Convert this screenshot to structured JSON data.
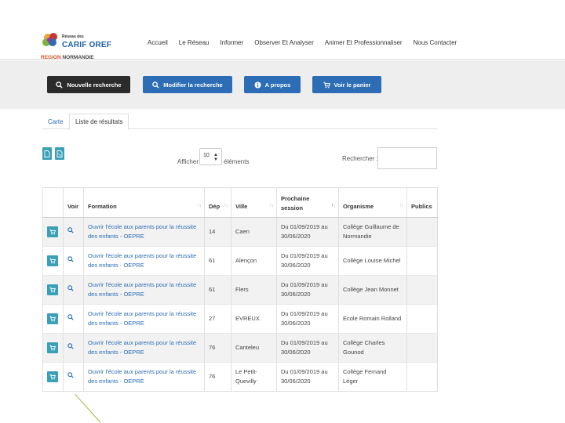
{
  "logo": {
    "network_label": "Réseau des",
    "brand": "CARIF OREF",
    "region_prefix": "REGION",
    "region_name": "NORMANDIE"
  },
  "nav": {
    "items": [
      "Accueil",
      "Le Réseau",
      "Informer",
      "Observer Et Analyser",
      "Animer Et Professionnaliser",
      "Nous Contacter"
    ]
  },
  "toolbar": {
    "new_search": "Nouvelle recherche",
    "modify_search": "Modifier la recherche",
    "about": "A propos",
    "view_cart": "Voir le panier"
  },
  "tabs": {
    "map": "Carte",
    "results": "Liste de résultats"
  },
  "listing": {
    "show_label": "Afficher",
    "page_size": "10",
    "elements_label": "éléments",
    "search_label": "Rechercher :",
    "search_value": ""
  },
  "table": {
    "headers": {
      "voir": "Voir",
      "formation": "Formation",
      "dep": "Dép",
      "ville": "Ville",
      "session": "Prochaine session",
      "organisme": "Organisme",
      "publics": "Publics"
    },
    "rows": [
      {
        "formation": "Ouvrir l'école aux parents pour la réussite des enfants - OEPRE",
        "dep": "14",
        "ville": "Caen",
        "session": "Du 01/09/2019 au 30/06/2020",
        "organisme": "Collège Guillaume de Normandie",
        "publics": ""
      },
      {
        "formation": "Ouvrir l'école aux parents pour la réussite des enfants - OEPRE",
        "dep": "61",
        "ville": "Alençon",
        "session": "Du 01/09/2019 au 30/06/2020",
        "organisme": "Collège Louise Michel",
        "publics": ""
      },
      {
        "formation": "Ouvrir l'école aux parents pour la réussite des enfants - OEPRE",
        "dep": "61",
        "ville": "Flers",
        "session": "Du 01/09/2019 au 30/06/2020",
        "organisme": "Collège Jean Monnet",
        "publics": ""
      },
      {
        "formation": "Ouvrir l'école aux parents pour la réussite des enfants - OEPRE",
        "dep": "27",
        "ville": "EVREUX",
        "session": "Du 01/09/2019 au 30/06/2020",
        "organisme": "Ecole Romain Rolland",
        "publics": ""
      },
      {
        "formation": "Ouvrir l'école aux parents pour la réussite des enfants - OEPRE",
        "dep": "76",
        "ville": "Canteleu",
        "session": "Du 01/09/2019 au 30/06/2020",
        "organisme": "Collège Charles Gounod",
        "publics": ""
      },
      {
        "formation": "Ouvrir l'école aux parents pour la réussite des enfants - OEPRE",
        "dep": "76",
        "ville": "Le Petit-Quevilly",
        "session": "Du 01/09/2019 au 30/06/2020",
        "organisme": "Collège Fernand Léger",
        "publics": ""
      }
    ]
  },
  "colors": {
    "brand_blue": "#2c6db5",
    "teal": "#3aa0b8",
    "dark_button": "#2b2b2b",
    "region_orange": "#d4542a"
  }
}
